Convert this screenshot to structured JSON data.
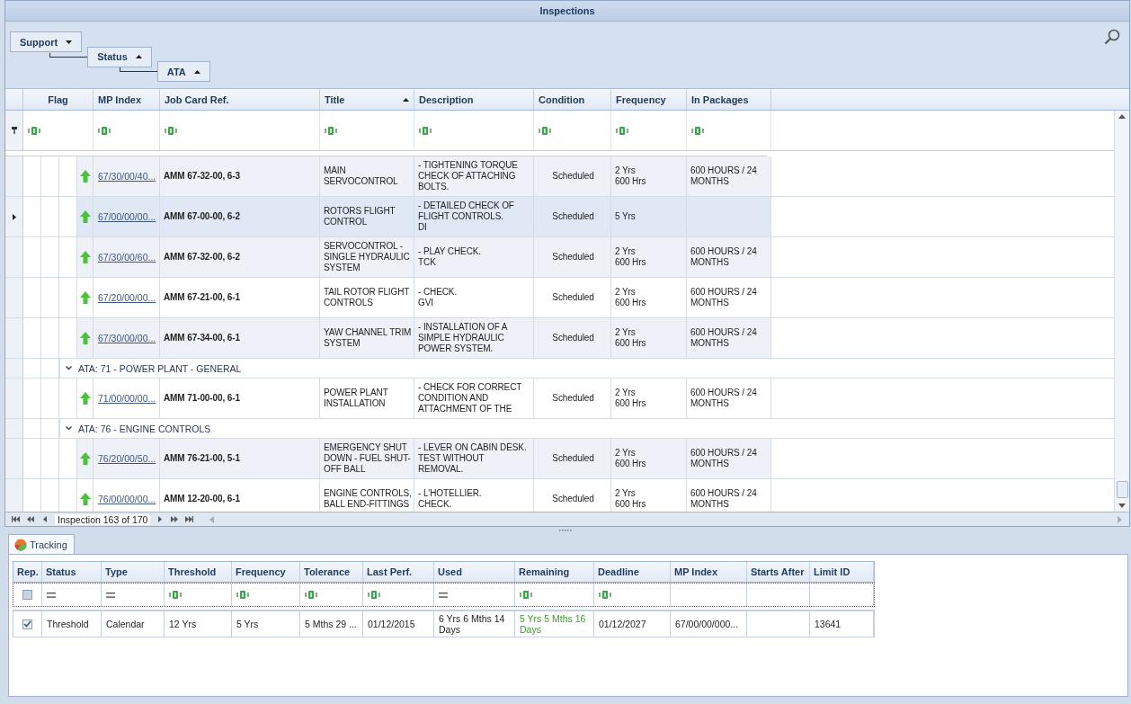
{
  "window": {
    "title": "Inspections"
  },
  "group_panel": {
    "groups": [
      {
        "label": "Support",
        "descending": true
      },
      {
        "label": "Status",
        "descending": false
      },
      {
        "label": "ATA",
        "descending": false
      }
    ]
  },
  "grid": {
    "columns": [
      {
        "label": "Flag",
        "kind": "text"
      },
      {
        "label": "MP Index",
        "kind": "text"
      },
      {
        "label": "Job Card Ref.",
        "kind": "text"
      },
      {
        "label": "Title",
        "kind": "text",
        "sorted": true
      },
      {
        "label": "Description",
        "kind": "text"
      },
      {
        "label": "Condition",
        "kind": "text"
      },
      {
        "label": "Frequency",
        "kind": "text"
      },
      {
        "label": "In Packages",
        "kind": "text"
      }
    ],
    "rows": [
      {
        "kind": "record",
        "selected": false,
        "mp_index": "67/30/00/40...",
        "job_card": "AMM 67-32-00, 6-3",
        "title": "MAIN SERVOCONTROL",
        "description": "- TIGHTENING TORQUE CHECK OF ATTACHING BOLTS.",
        "condition": "Scheduled",
        "frequency": "2 Yrs\n600 Hrs",
        "in_packages": "600 HOURS / 24 MONTHS"
      },
      {
        "kind": "record",
        "selected": true,
        "mp_index": "67/00/00/00...",
        "job_card": "AMM 67-00-00, 6-2",
        "title": "ROTORS FLIGHT CONTROL",
        "description": "- DETAILED CHECK OF FLIGHT CONTROLS.\nDI",
        "condition": "Scheduled",
        "frequency": "5 Yrs"
      },
      {
        "kind": "record",
        "selected": false,
        "mp_index": "67/30/00/60...",
        "job_card": "AMM 67-32-00, 6-2",
        "title": "SERVOCONTROL - SINGLE HYDRAULIC SYSTEM",
        "description": "- PLAY CHECK.\nTCK",
        "condition": "Scheduled",
        "frequency": "2 Yrs\n600 Hrs",
        "in_packages": "600 HOURS / 24 MONTHS"
      },
      {
        "kind": "record",
        "selected": false,
        "mp_index": "67/20/00/00...",
        "job_card": "AMM 67-21-00, 6-1",
        "title": "TAIL ROTOR FLIGHT CONTROLS",
        "description": "- CHECK.\nGVI",
        "condition": "Scheduled",
        "frequency": "2 Yrs\n600 Hrs",
        "in_packages": "600 HOURS / 24 MONTHS"
      },
      {
        "kind": "record",
        "selected": false,
        "mp_index": "67/30/00/00...",
        "job_card": "AMM 67-34-00, 6-1",
        "title": "YAW CHANNEL TRIM SYSTEM",
        "description": "- INSTALLATION OF A SIMPLE HYDRAULIC POWER SYSTEM.",
        "condition": "Scheduled",
        "frequency": "2 Yrs\n600 Hrs",
        "in_packages": "600 HOURS / 24 MONTHS"
      },
      {
        "kind": "group",
        "expanded": true,
        "label": "ATA: 71 - POWER PLANT - GENERAL"
      },
      {
        "kind": "record",
        "selected": false,
        "mp_index": "71/00/00/00...",
        "job_card": "AMM 71-00-00, 6-1",
        "title": "POWER PLANT INSTALLATION",
        "description": "- CHECK FOR CORRECT CONDITION AND ATTACHMENT OF THE",
        "condition": "Scheduled",
        "frequency": "2 Yrs\n600 Hrs",
        "in_packages": "600 HOURS / 24 MONTHS"
      },
      {
        "kind": "group",
        "expanded": true,
        "label": "ATA: 76 - ENGINE CONTROLS"
      },
      {
        "kind": "record",
        "selected": false,
        "mp_index": "76/20/00/50...",
        "job_card": "AMM 76-21-00, 5-1",
        "title": "EMERGENCY SHUT DOWN - FUEL SHUT-OFF BALL",
        "description": "- LEVER ON CABIN DESK.\nTEST WITHOUT REMOVAL.",
        "condition": "Scheduled",
        "frequency": "2 Yrs\n600 Hrs",
        "in_packages": "600 HOURS / 24 MONTHS"
      },
      {
        "kind": "record",
        "selected": false,
        "mp_index": "76/00/00/00...",
        "job_card": "AMM 12-20-00, 6-1",
        "title": "ENGINE CONTROLS, BALL END-FITTINGS",
        "description": "- L'HOTELLIER.\nCHECK.",
        "condition": "Scheduled",
        "frequency": "2 Yrs\n600 Hrs",
        "in_packages": "600 HOURS / 24 MONTHS"
      }
    ],
    "navigator": {
      "text": "Inspection 163 of 170"
    }
  },
  "tracking": {
    "tab": {
      "label": "Tracking",
      "selected": true
    },
    "columns": [
      {
        "label": "Rep.",
        "kind": "checkbox",
        "filter_checked": false
      },
      {
        "label": "Status",
        "kind": "equals"
      },
      {
        "label": "Type",
        "kind": "equals"
      },
      {
        "label": "Threshold",
        "kind": "text"
      },
      {
        "label": "Frequency",
        "kind": "text"
      },
      {
        "label": "Tolerance",
        "kind": "text"
      },
      {
        "label": "Last Perf.",
        "kind": "text"
      },
      {
        "label": "Used",
        "kind": "equals"
      },
      {
        "label": "Remaining",
        "kind": "text"
      },
      {
        "label": "Deadline",
        "kind": "text"
      },
      {
        "label": "MP Index",
        "kind": "plain"
      },
      {
        "label": "Starts After",
        "kind": "plain"
      },
      {
        "label": "Limit ID",
        "kind": "plain"
      }
    ],
    "rows": [
      {
        "rep": true,
        "status": "Threshold",
        "type": "Calendar",
        "threshold": "12 Yrs",
        "frequency": "5 Yrs",
        "tolerance": "5 Mths 29 ...",
        "last_perf": "01/12/2015",
        "used": "6 Yrs 6 Mths 14 Days",
        "remaining": "5 Yrs 5 Mths 16 Days",
        "remaining_ok": true,
        "deadline": "01/12/2027",
        "mp_index": "67/00/00/000...",
        "limit_id": "13641"
      }
    ]
  }
}
